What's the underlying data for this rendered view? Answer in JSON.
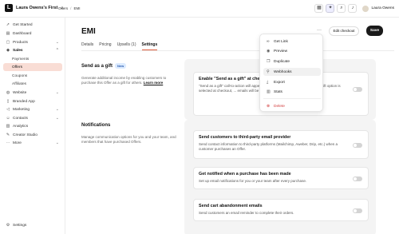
{
  "topbar": {
    "brand_initial": "L",
    "brand_name": "Laura Owens's First",
    "breadcrumb": [
      "Offers",
      "EMI"
    ],
    "user_name": "Laura Owens"
  },
  "sidebar": {
    "items": [
      {
        "label": "Get Started",
        "icon": "rocket-icon"
      },
      {
        "label": "Dashboard",
        "icon": "dashboard-icon"
      },
      {
        "label": "Products",
        "icon": "box-icon"
      },
      {
        "label": "Sales",
        "icon": "tag-icon"
      },
      {
        "label": "Payments"
      },
      {
        "label": "Offers"
      },
      {
        "label": "Coupons"
      },
      {
        "label": "Affiliates"
      },
      {
        "label": "Website",
        "icon": "globe-icon"
      },
      {
        "label": "Branded App",
        "icon": "phone-icon"
      },
      {
        "label": "Marketing",
        "icon": "megaphone-icon"
      },
      {
        "label": "Contacts",
        "icon": "contacts-icon"
      },
      {
        "label": "Analytics",
        "icon": "chart-icon"
      },
      {
        "label": "Creator Studio",
        "icon": "studio-icon"
      },
      {
        "label": "More",
        "icon": "more-icon"
      }
    ],
    "settings_label": "Settings"
  },
  "main": {
    "title": "EMI",
    "tabs": [
      "Details",
      "Pricing",
      "Upsells (1)",
      "Settings"
    ],
    "edit_button": "Edit checkout",
    "save_button": "Save",
    "more_dots": "···"
  },
  "send_gift": {
    "title": "Send as a gift",
    "badge": "New",
    "desc": "Generate additional income by enabling customers to purchase this Offer as a gift for others.",
    "learn_more": "Learn more",
    "card_title": "Enable \"Send as a gift\" at checkout",
    "card_desc": "\"Send as a gift\" call-to-action will appear at checkout. Payment Offers only. If gift option is selected at checkout, ... emails will be disabled."
  },
  "notifications": {
    "title": "Notifications",
    "desc": "Manage communication options for you and your team, and members that have purchased Offers.",
    "cards": [
      {
        "title": "Send customers to third-party email provider",
        "desc": "Send contact information to third-party platforms (Mailchimp, Aweber, Drip, etc.) when a customer purchases an Offer."
      },
      {
        "title": "Get notified when a purchase has been made",
        "desc": "Set up email notifications for you or your team after every purchase."
      },
      {
        "title": "Send cart abandonment emails",
        "desc": "Send customers an email reminder to complete their orders."
      }
    ]
  },
  "menu": {
    "items": [
      {
        "label": "Get Link",
        "icon": "link-icon"
      },
      {
        "label": "Preview",
        "icon": "eye-icon"
      },
      {
        "label": "Duplicate",
        "icon": "copy-icon"
      },
      {
        "label": "Webhooks",
        "icon": "webhook-icon"
      },
      {
        "label": "Export",
        "icon": "download-icon"
      },
      {
        "label": "Stats",
        "icon": "stats-icon"
      },
      {
        "label": "Delete",
        "icon": "x-circle-icon"
      }
    ]
  },
  "colors": {
    "accent": "#e05a3a",
    "selected_bg": "#f9ddd5",
    "danger": "#d23c3c"
  }
}
